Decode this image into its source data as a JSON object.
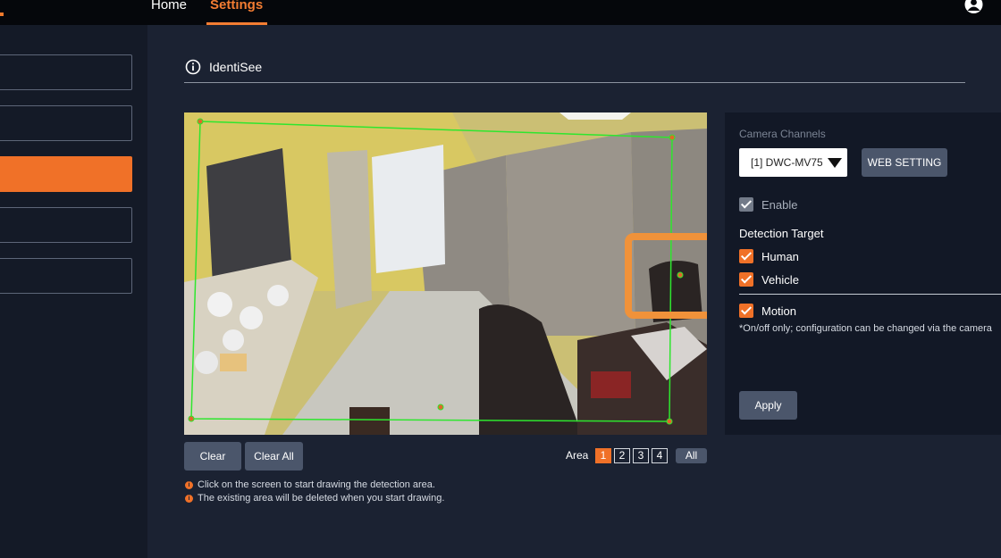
{
  "nav": {
    "home": "Home",
    "settings": "Settings"
  },
  "header": {
    "title": "IdentiSee"
  },
  "camera_view": {
    "region_color": "#2ee62e",
    "highlight_color": "#f0923a"
  },
  "controls": {
    "clear": "Clear",
    "clear_all": "Clear All",
    "area_label": "Area",
    "areas": [
      "1",
      "2",
      "3",
      "4"
    ],
    "active_area": "1",
    "all": "All"
  },
  "notes": [
    "Click on the screen to start drawing the detection area.",
    "The existing area will be deleted when you start drawing."
  ],
  "panel": {
    "camera_channels_label": "Camera Channels",
    "camera_channel_value": "[1] DWC-MV75'",
    "web_setting": "WEB SETTING",
    "enable": {
      "label": "Enable",
      "checked": true
    },
    "detection_target_label": "Detection Target",
    "human": {
      "label": "Human",
      "checked": true
    },
    "vehicle": {
      "label": "Vehicle",
      "checked": true
    },
    "motion": {
      "label": "Motion",
      "checked": true
    },
    "motion_note": "*On/off only; configuration can be changed via the camera",
    "apply": "Apply"
  },
  "colors": {
    "accent": "#f07128",
    "background": "#1b2232",
    "sidebar": "#141a27",
    "topbar": "#05070b"
  }
}
